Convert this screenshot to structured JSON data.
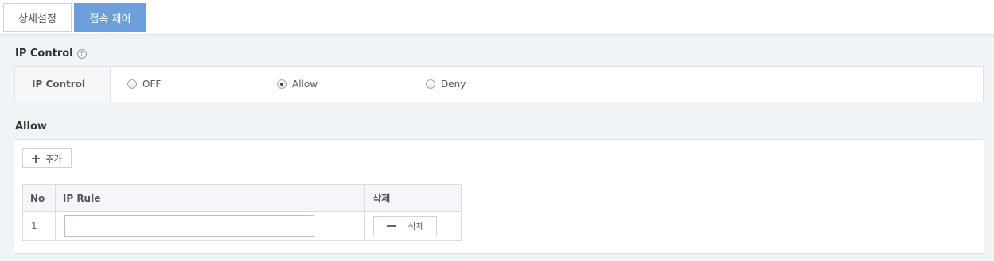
{
  "tabs": [
    {
      "label": "상세설정",
      "active": false
    },
    {
      "label": "접속 제어",
      "active": true
    }
  ],
  "ip_control": {
    "section_title": "IP Control",
    "help_icon": "question-circle-icon",
    "row_label": "IP Control",
    "options": [
      {
        "label": "OFF",
        "checked": false
      },
      {
        "label": "Allow",
        "checked": true
      },
      {
        "label": "Deny",
        "checked": false
      }
    ]
  },
  "allow": {
    "section_title": "Allow",
    "add_label": "추가",
    "table": {
      "headers": [
        "No",
        "IP Rule",
        "삭제"
      ],
      "rows": [
        {
          "no": "1",
          "ip_rule": "",
          "delete_label": "삭제"
        }
      ]
    }
  },
  "colors": {
    "active_tab": "#6d9fdc",
    "background": "#f1f4f7"
  }
}
